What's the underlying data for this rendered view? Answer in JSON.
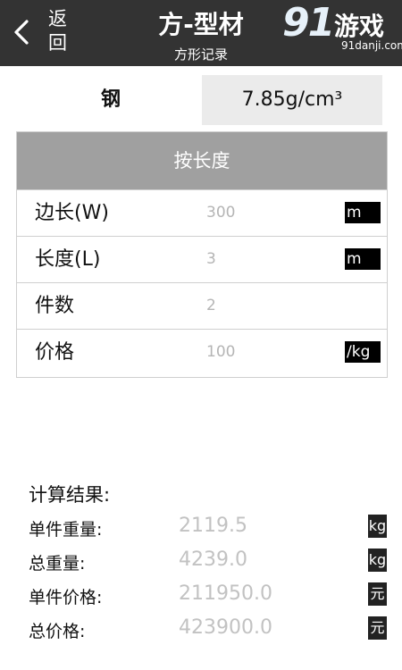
{
  "header": {
    "back_label": "返\n回",
    "title": "方-型材",
    "subtitle": "方形记录",
    "watermark": {
      "number": "91",
      "text": "游戏",
      "url": "91danji.com"
    }
  },
  "material": {
    "name": "钢",
    "density": "7.85g/cm³"
  },
  "form": {
    "mode_label": "按长度",
    "rows": [
      {
        "label": "边长(W)",
        "value": "300",
        "unit": "m"
      },
      {
        "label": "长度(L)",
        "value": "3",
        "unit": "m"
      },
      {
        "label": "件数",
        "value": "2",
        "unit": ""
      },
      {
        "label": "价格",
        "value": "100",
        "unit": "/kg"
      }
    ]
  },
  "results": {
    "title": "计算结果:",
    "rows": [
      {
        "label": "单件重量:",
        "value": "2119.5",
        "unit": "kg"
      },
      {
        "label": "总重量:",
        "value": "4239.0",
        "unit": "kg"
      },
      {
        "label": "单件价格:",
        "value": "211950.0",
        "unit": "元"
      },
      {
        "label": "总价格:",
        "value": "423900.0",
        "unit": "元"
      }
    ]
  },
  "colors": {
    "header_bg": "#333333",
    "mode_bar_bg": "#a0a0a0",
    "density_bg": "#ebebeb",
    "placeholder_text": "#b5b5b5",
    "unit_badge_bg": "#000000"
  }
}
